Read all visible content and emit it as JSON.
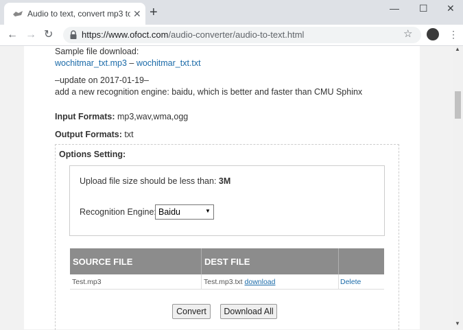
{
  "browser": {
    "tab_title": "Audio to text, convert mp3 to te",
    "tab_close": "✕",
    "new_tab": "+",
    "win_min": "—",
    "win_max": "☐",
    "win_close": "✕",
    "back": "←",
    "forward": "→",
    "reload": "↻",
    "url_host": "https://www.ofoct.com",
    "url_path": "/audio-converter/audio-to-text.html",
    "star": "☆",
    "menu": "⋮"
  },
  "content": {
    "sample_label": "Sample file download:",
    "sample_link_mp3": "wochitmar_txt.mp3",
    "sample_sep": " – ",
    "sample_link_txt": "wochitmar_txt.txt",
    "update_date": "–update on 2017-01-19–",
    "update_note": "add a new recognition engine: baidu, which is better and faster than CMU Sphinx",
    "input_formats_label": "Input Formats:",
    "input_formats_value": " mp3,wav,wma,ogg",
    "output_formats_label": "Output Formats:",
    "output_formats_value": " txt"
  },
  "options": {
    "title": "Options Setting:",
    "upload_limit_label": "Upload file size should be less than: ",
    "upload_limit_value": "3M",
    "engine_label": "Recognition Engine:",
    "engine_selected": "Baidu"
  },
  "files_table": {
    "headers": [
      "SOURCE FILE",
      "DEST FILE",
      ""
    ],
    "rows": [
      {
        "source": "Test.mp3",
        "dest": "Test.mp3.txt",
        "download": "download",
        "delete": "Delete"
      }
    ]
  },
  "actions": {
    "convert": "Convert",
    "download_all": "Download All"
  },
  "colors": {
    "link": "#1a6aa8",
    "table_header": "#8c8c8c"
  }
}
